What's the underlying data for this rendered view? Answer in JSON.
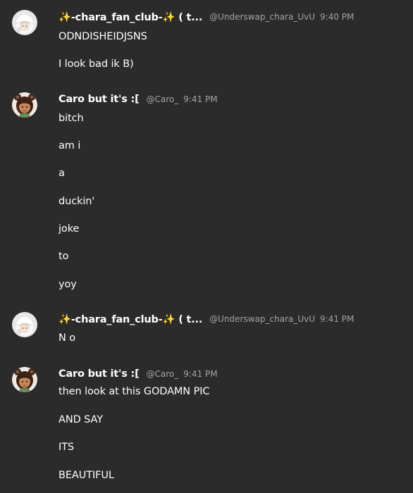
{
  "groups": [
    {
      "username": "✨-chara_fan_club-✨ ( t...",
      "handle": "@Underswap_chara_UvU",
      "timestamp": "9:40 PM",
      "avatar_icon": "white-hooded-avatar-icon",
      "messages": [
        "ODNDISHEIDJSNS",
        "I look bad ik B)"
      ]
    },
    {
      "username": "Caro but it's :[",
      "handle": "@Caro_",
      "timestamp": "9:41 PM",
      "avatar_icon": "bear-ears-girl-avatar-icon",
      "messages": [
        "bitch",
        "am i",
        "a",
        "duckin'",
        "joke",
        "to",
        "yoy"
      ]
    },
    {
      "username": "✨-chara_fan_club-✨ ( t...",
      "handle": "@Underswap_chara_UvU",
      "timestamp": "9:41 PM",
      "avatar_icon": "white-hooded-avatar-icon",
      "messages": [
        "N o"
      ]
    },
    {
      "username": "Caro but it's :[",
      "handle": "@Caro_",
      "timestamp": "9:41 PM",
      "avatar_icon": "bear-ears-girl-avatar-icon",
      "messages": [
        "then look at this GODAMN PIC",
        "AND SAY",
        "ITS",
        "BEAUTIFUL"
      ]
    }
  ],
  "colors": {
    "background": "#2c2b2b",
    "text": "#ffffff",
    "muted": "#a3a3a3"
  }
}
